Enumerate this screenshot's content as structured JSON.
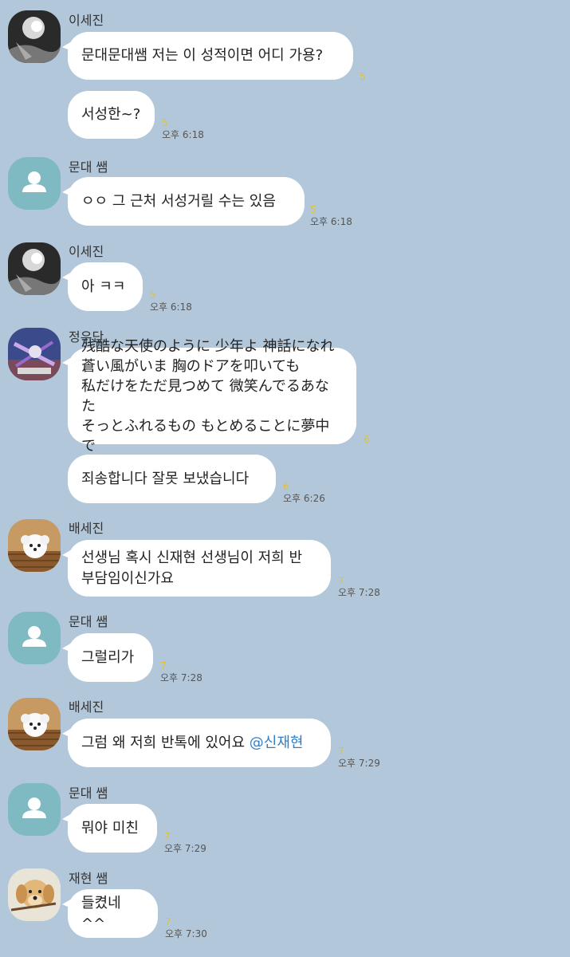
{
  "messages": [
    {
      "sender": "이세진",
      "avatar": "photo-dark"
    },
    {
      "text": "문대문대쌤 저는 이 성적이면 어디 가용?",
      "unread": "5"
    },
    {
      "text": "서성한~?",
      "unread": "5",
      "time": "오후 6:18"
    },
    {
      "sender": "문대 쌤",
      "avatar": "default-person"
    },
    {
      "text": "ㅇㅇ 그 근처 서성거릴 수는 있음",
      "unread": "5",
      "time": "오후 6:18"
    },
    {
      "sender": "이세진",
      "avatar": "photo-dark"
    },
    {
      "text": "아 ㅋㅋ",
      "unread": "5",
      "time": "오후 6:18"
    },
    {
      "sender": "정우단",
      "avatar": "anime-art"
    },
    {
      "text": "残酷な天使のように 少年よ  神話になれ\n蒼い風がいま 胸のドアを叩いても\n私だけをただ見つめて 微笑んでるあなた\nそっとふれるもの もとめることに夢中で",
      "unread": "6"
    },
    {
      "text": "죄송합니다 잘못 보냈습니다",
      "unread": "6",
      "time": "오후 6:26"
    },
    {
      "sender": "배세진",
      "avatar": "white-dog"
    },
    {
      "text": "선생님 혹시 신재현 선생님이 저희 반\n부담임이신가요",
      "unread": "7",
      "time": "오후 7:28"
    },
    {
      "sender": "문대 쌤",
      "avatar": "default-person"
    },
    {
      "text": "그럴리가",
      "unread": "7",
      "time": "오후 7:28"
    },
    {
      "sender": "배세진",
      "avatar": "white-dog"
    },
    {
      "text": "그럼 왜 저희 반톡에 있어요 ",
      "mention": "@신재현",
      "unread": "7",
      "time": "오후 7:29"
    },
    {
      "sender": "문대 쌤",
      "avatar": "default-person"
    },
    {
      "text": "뭐야 미친",
      "unread": "7",
      "time": "오후 7:29"
    },
    {
      "sender": "재현 쌤",
      "avatar": "puppy"
    },
    {
      "text": "들켰네 ^^",
      "unread": "7",
      "time": "오후 7:30"
    }
  ],
  "colors": {
    "background": "#b2c7da",
    "bubble": "#ffffff",
    "unread": "#e0c23a",
    "mention": "#2f7fc8",
    "default_avatar": "#7fb9c1"
  }
}
